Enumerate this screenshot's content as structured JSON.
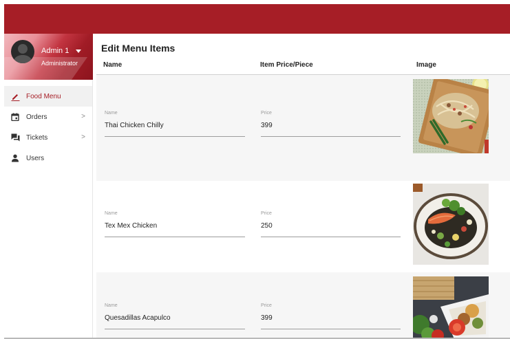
{
  "header": {
    "color": "#a61e26"
  },
  "profile": {
    "name": "Admin 1",
    "role": "Administrator"
  },
  "nav": {
    "items": [
      {
        "label": "Food Menu",
        "icon": "edit-pencil-icon",
        "active": true
      },
      {
        "label": "Orders",
        "icon": "calendar-icon",
        "has_chevron": true
      },
      {
        "label": "Tickets",
        "icon": "chat-bubbles-icon",
        "has_chevron": true
      },
      {
        "label": "Users",
        "icon": "person-icon"
      }
    ],
    "chevron": ">"
  },
  "main": {
    "title": "Edit Menu Items",
    "columns": {
      "name": "Name",
      "price": "Item Price/Piece",
      "image": "Image"
    },
    "field_labels": {
      "name": "Name",
      "price": "Price"
    },
    "items": [
      {
        "name": "Thai Chicken Chilly",
        "price": "399",
        "image": "pad-thai-noodles-photo"
      },
      {
        "name": "Tex Mex Chicken",
        "price": "250",
        "image": "salmon-salad-plate-photo"
      },
      {
        "name": "Quesadillas Acapulco",
        "price": "399",
        "image": "quesadilla-platter-photo"
      }
    ]
  }
}
